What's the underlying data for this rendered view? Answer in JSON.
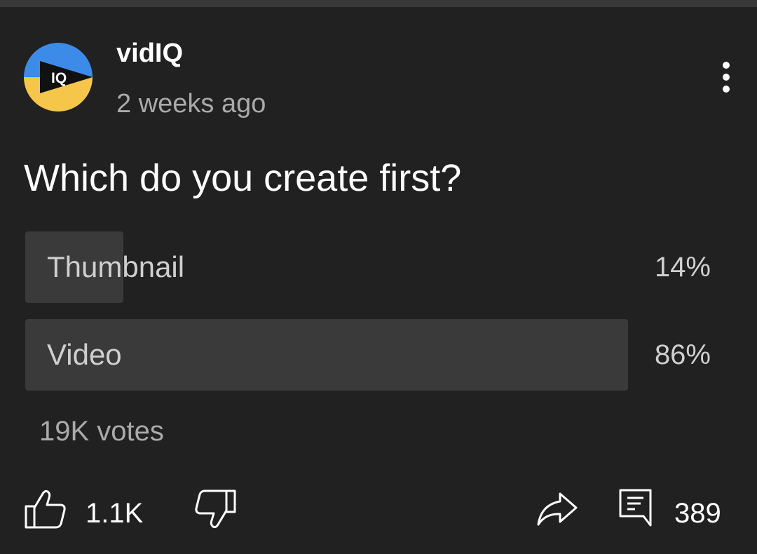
{
  "channel": {
    "name": "vidIQ",
    "posted": "2 weeks ago",
    "avatar_text": "IQ",
    "avatar_colors": {
      "top": "#3d8be8",
      "bottom": "#f5c64a",
      "play": "#111111",
      "text": "#ffffff"
    }
  },
  "post": {
    "question": "Which do you create first?"
  },
  "poll": {
    "options": [
      {
        "label": "Thumbnail",
        "percent_text": "14%",
        "percent": 14
      },
      {
        "label": "Video",
        "percent_text": "86%",
        "percent": 86
      }
    ],
    "votes": "19K votes"
  },
  "actions": {
    "like_count": "1.1K",
    "comment_count": "389"
  },
  "icons": {
    "more": "vertical-dots-icon",
    "like": "thumb-up-icon",
    "dislike": "thumb-down-icon",
    "share": "share-arrow-icon",
    "comment": "comment-icon"
  },
  "colors": {
    "background": "#212121",
    "poll_fill": "#3a3a3a",
    "primary_text": "#ffffff",
    "secondary_text": "#aaaaaa"
  }
}
